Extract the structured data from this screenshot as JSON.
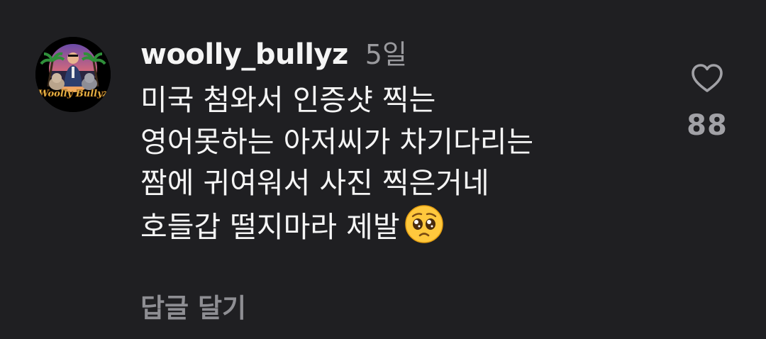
{
  "comment": {
    "username": "woolly_bullyz",
    "time": "5일",
    "text_lines": [
      "미국 첨와서 인증샷 찍는",
      "영어못하는 아저씨가 차기다리는",
      "짬에 귀여워서 사진 찍은거네",
      "호들갑 떨지마라 제발"
    ],
    "emoji_icon": "pleading-face-emoji",
    "reply_label": "답글 달기",
    "like_icon": "heart-outline-icon",
    "like_count": "88",
    "avatar_text": "Woolly Bullyz"
  },
  "colors": {
    "background": "#1f1f22",
    "primary_text": "#f5f5f5",
    "secondary_text": "#9a9a9e"
  }
}
